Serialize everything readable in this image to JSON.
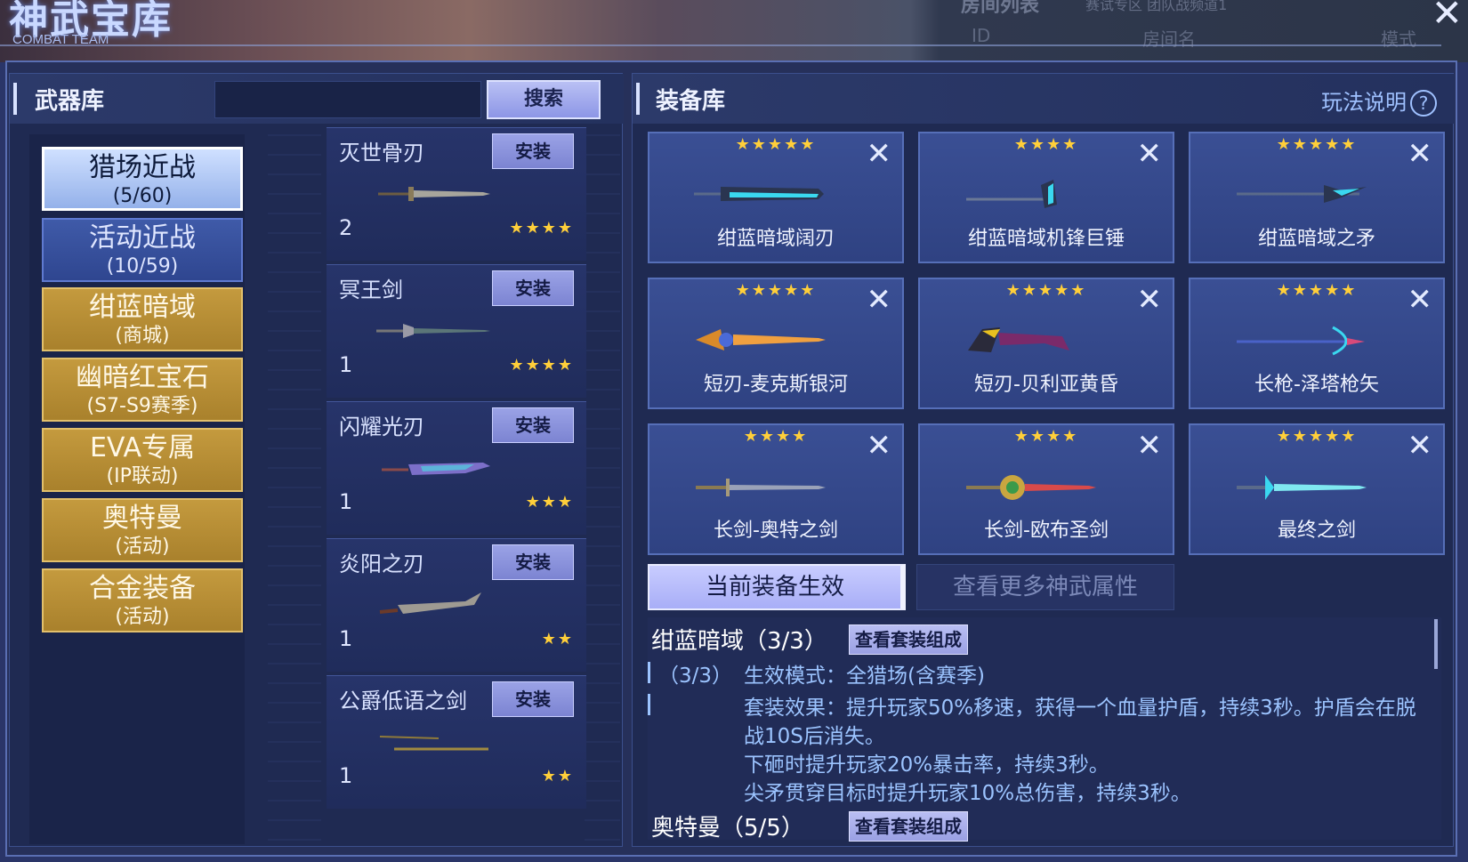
{
  "banner": {
    "title": "神武宝库",
    "subtitle": "COMBAT TEAM",
    "room_list_title": "房间列表",
    "room_list_sub": "赛试专区  团队战频道1",
    "col_id": "ID",
    "col_name": "房间名",
    "col_mode": "模式",
    "close": "✕"
  },
  "weapon_lib": {
    "label": "武器库",
    "search_value": "",
    "search_button": "搜索",
    "categories": [
      {
        "l1": "猎场近战",
        "l2": "(5/60)",
        "state": "selected"
      },
      {
        "l1": "活动近战",
        "l2": "(10/59)",
        "state": "blue"
      },
      {
        "l1": "绀蓝暗域",
        "l2": "(商城)",
        "state": "gold"
      },
      {
        "l1": "幽暗红宝石",
        "l2": "(S7-S9赛季)",
        "state": "gold"
      },
      {
        "l1": "EVA专属",
        "l2": "(IP联动)",
        "state": "gold"
      },
      {
        "l1": "奥特曼",
        "l2": "(活动)",
        "state": "gold"
      },
      {
        "l1": "合金装备",
        "l2": "(活动)",
        "state": "gold"
      }
    ],
    "weapons": [
      {
        "name": "灭世骨刃",
        "install": "安装",
        "count": "2",
        "stars": "★★★★",
        "star_count": 4
      },
      {
        "name": "冥王剑",
        "install": "安装",
        "count": "1",
        "stars": "★★★★",
        "star_count": 4
      },
      {
        "name": "闪耀光刃",
        "install": "安装",
        "count": "1",
        "stars": "★★★",
        "star_count": 3
      },
      {
        "name": "炎阳之刃",
        "install": "安装",
        "count": "1",
        "stars": "★★",
        "star_count": 2
      },
      {
        "name": "公爵低语之剑",
        "install": "安装",
        "count": "1",
        "stars": "★★",
        "star_count": 2
      }
    ]
  },
  "equip_lib": {
    "label": "装备库",
    "help": "玩法说明",
    "help_icon": "?",
    "items": [
      {
        "name": "绀蓝暗域阔刃",
        "stars": "★★★★★",
        "close": "✕"
      },
      {
        "name": "绀蓝暗域机锋巨锤",
        "stars": "★★★★",
        "close": "✕"
      },
      {
        "name": "绀蓝暗域之矛",
        "stars": "★★★★★",
        "close": "✕"
      },
      {
        "name": "短刃-麦克斯银河",
        "stars": "★★★★★",
        "close": "✕"
      },
      {
        "name": "短刃-贝利亚黄昏",
        "stars": "★★★★★",
        "close": "✕"
      },
      {
        "name": "长枪-泽塔枪矢",
        "stars": "★★★★★",
        "close": "✕"
      },
      {
        "name": "长剑-奥特之剑",
        "stars": "★★★★",
        "close": "✕"
      },
      {
        "name": "长剑-欧布圣剑",
        "stars": "★★★★",
        "close": "✕"
      },
      {
        "name": "最终之剑",
        "stars": "★★★★★",
        "close": "✕"
      }
    ],
    "tab_active": "当前装备生效",
    "tab_inactive": "查看更多神武属性",
    "sets": {
      "set1_title": "绀蓝暗域（3/3）",
      "set1_button": "查看套装组成",
      "line1_prefix": "（3/3）",
      "line1_text": "生效模式：全猎场(含赛季)",
      "line2_text": "套装效果：提升玩家50%移速，获得一个血量护盾，持续3秒。护盾会在脱",
      "line3_text": "战10S后消失。",
      "line4_text": "下砸时提升玩家20%暴击率，持续3秒。",
      "line5_text": "尖矛贯穿目标时提升玩家10%总伤害，持续3秒。",
      "set2_title": "奥特曼（5/5）",
      "set2_button": "查看套装组成"
    }
  },
  "colors": {
    "accent_gold": "#c49a3e",
    "star": "#ffcf3a",
    "button_lavender": "#a8aef7"
  }
}
